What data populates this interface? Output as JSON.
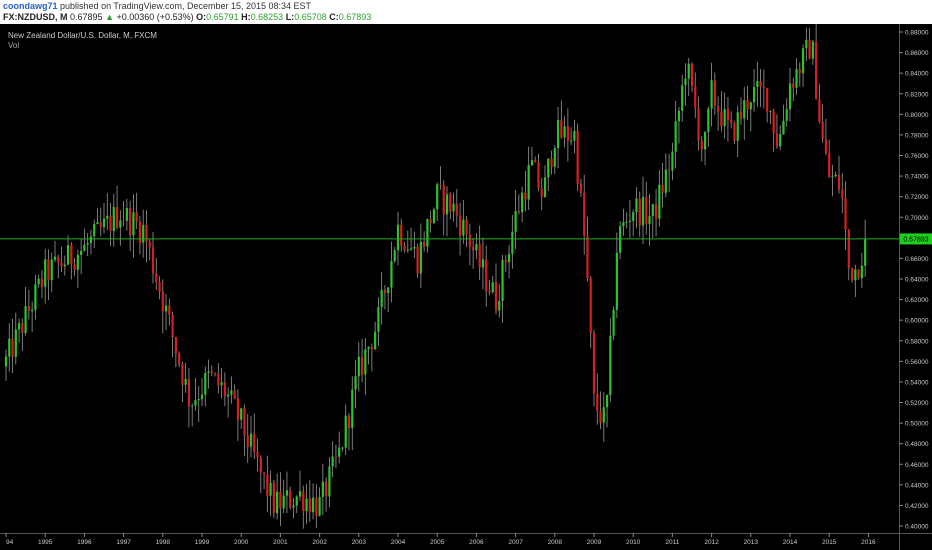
{
  "header": {
    "author": "coondawg71",
    "published_text": "published on TradingView.com, December 15, 2015 08:34 EST",
    "symbol": "FX:NZDUSD, M",
    "last_price": "0.67895",
    "change_arrow": "▲",
    "change": "+0.00360 (+0.53%)",
    "o_label": "O:",
    "o_value": "0.65791",
    "h_label": "H:",
    "h_value": "0.68253",
    "l_label": "L:",
    "l_value": "0.65708",
    "c_label": "C:",
    "c_value": "0.67893"
  },
  "legend": {
    "title": "New Zealand Dollar/U.S. Dollar, M, FXCM",
    "volume_label": "Vol"
  },
  "price_tag": "0.67893",
  "colors": {
    "background": "#000000",
    "up": "#2fc22f",
    "down": "#d81f1f",
    "price_line": "#1fae1f",
    "axis_text": "#cccccc"
  },
  "chart_data": {
    "type": "candlestick",
    "title": "New Zealand Dollar/U.S. Dollar, M, FXCM",
    "interval": "monthly",
    "ylim": [
      0.388,
      0.884
    ],
    "y_ticks": [
      "0.88000",
      "0.86000",
      "0.84000",
      "0.82000",
      "0.80000",
      "0.78000",
      "0.76000",
      "0.74000",
      "0.72000",
      "0.70000",
      "0.68000",
      "0.66000",
      "0.64000",
      "0.62000",
      "0.60000",
      "0.58000",
      "0.56000",
      "0.54000",
      "0.52000",
      "0.50000",
      "0.48000",
      "0.46000",
      "0.44000",
      "0.42000",
      "0.40000"
    ],
    "x_tick_labels": [
      "94",
      "1995",
      "1996",
      "1997",
      "1998",
      "1999",
      "2000",
      "2001",
      "2002",
      "2003",
      "2004",
      "2005",
      "2006",
      "2007",
      "2008",
      "2009",
      "2010",
      "2011",
      "2012",
      "2013",
      "2014",
      "2015",
      "2016"
    ],
    "x_tick_years": [
      1994,
      1995,
      1996,
      1997,
      1998,
      1999,
      2000,
      2001,
      2002,
      2003,
      2004,
      2005,
      2006,
      2007,
      2008,
      2009,
      2010,
      2011,
      2012,
      2013,
      2014,
      2015,
      2016
    ],
    "x_range": [
      1994,
      2016.6
    ],
    "last_close": 0.67893,
    "grid": false,
    "anchors_year": [
      1994.0,
      1995.0,
      1996.0,
      1996.9,
      1997.5,
      1998.0,
      1998.7,
      1999.2,
      1999.6,
      2000.0,
      2000.5,
      2000.85,
      2001.5,
      2002.0,
      2002.5,
      2003.0,
      2003.5,
      2004.0,
      2004.5,
      2005.0,
      2005.4,
      2005.8,
      2006.0,
      2006.5,
      2007.0,
      2007.4,
      2007.7,
      2008.0,
      2008.5,
      2008.8,
      2009.0,
      2009.3,
      2009.6,
      2010.0,
      2010.5,
      2011.0,
      2011.35,
      2011.6,
      2011.8,
      2012.0,
      2012.5,
      2013.0,
      2013.4,
      2013.7,
      2014.0,
      2014.3,
      2014.55,
      2014.8,
      2015.0,
      2015.3,
      2015.5,
      2015.7,
      2015.95
    ],
    "anchors_close": [
      0.56,
      0.645,
      0.67,
      0.705,
      0.688,
      0.62,
      0.52,
      0.545,
      0.53,
      0.5,
      0.45,
      0.42,
      0.43,
      0.42,
      0.47,
      0.55,
      0.6,
      0.69,
      0.66,
      0.72,
      0.71,
      0.68,
      0.66,
      0.62,
      0.7,
      0.75,
      0.72,
      0.78,
      0.78,
      0.66,
      0.52,
      0.5,
      0.68,
      0.71,
      0.7,
      0.76,
      0.85,
      0.8,
      0.76,
      0.82,
      0.78,
      0.82,
      0.82,
      0.77,
      0.83,
      0.85,
      0.87,
      0.78,
      0.74,
      0.73,
      0.65,
      0.65,
      0.679
    ]
  }
}
